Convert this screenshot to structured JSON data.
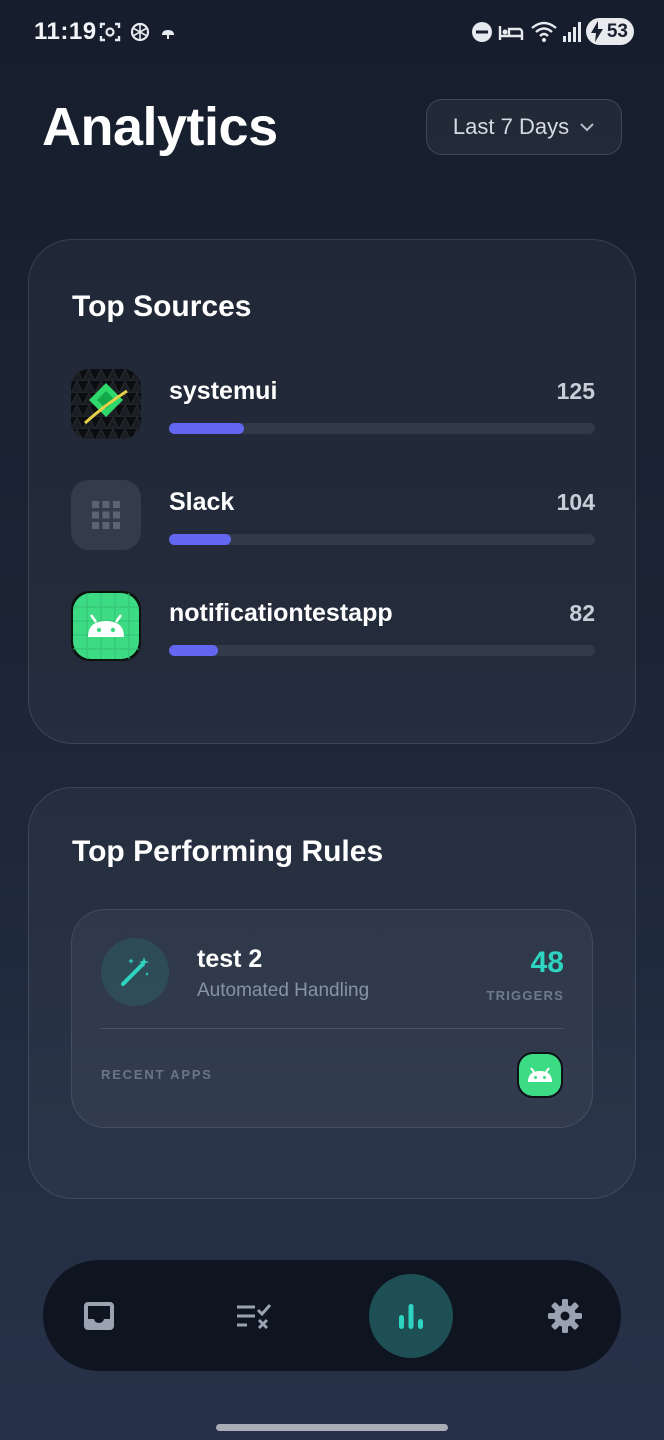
{
  "status_bar": {
    "time": "11:19",
    "battery": "53"
  },
  "header": {
    "title": "Analytics",
    "range_label": "Last 7 Days"
  },
  "top_sources": {
    "title": "Top Sources",
    "items": [
      {
        "name": "systemui",
        "count": "125",
        "share": 0.176,
        "icon": "systemui-app-icon"
      },
      {
        "name": "Slack",
        "count": "104",
        "share": 0.146,
        "icon": "grid-app-icon"
      },
      {
        "name": "notificationtestapp",
        "count": "82",
        "share": 0.115,
        "icon": "android-app-icon"
      }
    ],
    "bar_color": "#6366f1"
  },
  "top_rules": {
    "title": "Top Performing Rules",
    "rule": {
      "name": "test 2",
      "subtitle": "Automated Handling",
      "count": "48",
      "count_label": "TRIGGERS",
      "recent_label": "RECENT APPS",
      "icon": "magic-wand-icon"
    },
    "accent_color": "#2dd4bf"
  },
  "bottom_nav": {
    "items": [
      "inbox-icon",
      "rules-icon",
      "analytics-icon",
      "settings-icon"
    ],
    "active": "analytics-icon"
  }
}
